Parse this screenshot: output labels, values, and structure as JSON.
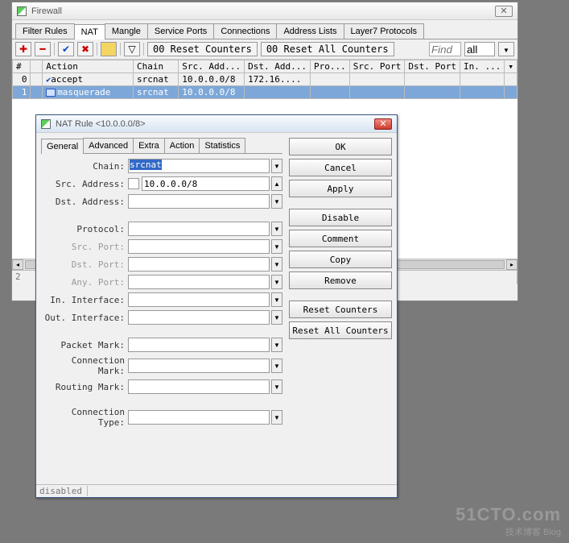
{
  "main": {
    "title": "Firewall",
    "tabs": [
      "Filter Rules",
      "NAT",
      "Mangle",
      "Service Ports",
      "Connections",
      "Address Lists",
      "Layer7 Protocols"
    ],
    "active_tab": 1,
    "toolbar": {
      "reset_counters": "00 Reset Counters",
      "reset_all_counters": "00 Reset All Counters",
      "find_placeholder": "Find",
      "filter_value": "all"
    },
    "columns": [
      "#",
      "",
      "Action",
      "Chain",
      "Src. Add...",
      "Dst. Add...",
      "Pro...",
      "Src. Port",
      "Dst. Port",
      "In. ...",
      "▾"
    ],
    "rows": [
      {
        "num": "0",
        "icon": "check",
        "action": "accept",
        "chain": "srcnat",
        "src": "10.0.0.0/8",
        "dst": "172.16....",
        "pro": "",
        "sport": "",
        "dport": "",
        "in": ""
      },
      {
        "num": "1",
        "icon": "masq",
        "action": "masquerade",
        "chain": "srcnat",
        "src": "10.0.0.0/8",
        "dst": "",
        "pro": "",
        "sport": "",
        "dport": "",
        "in": "",
        "selected": true
      }
    ],
    "status_left": "2"
  },
  "dialog": {
    "title": "NAT Rule <10.0.0.0/8>",
    "tabs": [
      "General",
      "Advanced",
      "Extra",
      "Action",
      "Statistics"
    ],
    "active_tab": 0,
    "fields": {
      "chain_label": "Chain:",
      "chain_value": "srcnat",
      "src_address_label": "Src. Address:",
      "src_address_value": "10.0.0.0/8",
      "dst_address_label": "Dst. Address:",
      "protocol_label": "Protocol:",
      "src_port_label": "Src. Port:",
      "dst_port_label": "Dst. Port:",
      "any_port_label": "Any. Port:",
      "in_interface_label": "In. Interface:",
      "out_interface_label": "Out. Interface:",
      "packet_mark_label": "Packet Mark:",
      "connection_mark_label": "Connection Mark:",
      "routing_mark_label": "Routing Mark:",
      "connection_type_label": "Connection Type:"
    },
    "buttons": {
      "ok": "OK",
      "cancel": "Cancel",
      "apply": "Apply",
      "disable": "Disable",
      "comment": "Comment",
      "copy": "Copy",
      "remove": "Remove",
      "reset_counters": "Reset Counters",
      "reset_all_counters": "Reset All Counters"
    },
    "status": "disabled"
  },
  "watermark": {
    "big": "51CTO.com",
    "small": "技术博客  Blog"
  }
}
